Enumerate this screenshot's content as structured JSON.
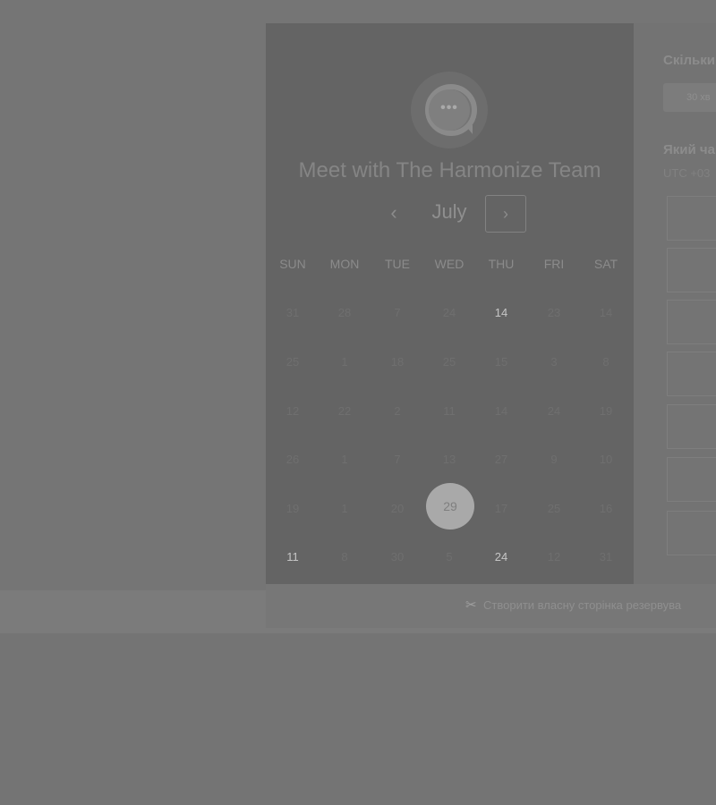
{
  "calendar": {
    "title": "Meet with The Harmonize Team",
    "logo_text": "•••",
    "month": "July",
    "prev_icon": "‹",
    "next_icon": "›",
    "weekdays": [
      "SUN",
      "MON",
      "TUE",
      "WED",
      "THU",
      "FRI",
      "SAT"
    ],
    "weeks": [
      [
        "31",
        "28",
        "7",
        "24",
        "14",
        "23",
        "14"
      ],
      [
        "25",
        "1",
        "18",
        "25",
        "15",
        "3",
        "8"
      ],
      [
        "12",
        "22",
        "2",
        "11",
        "14",
        "24",
        "19"
      ],
      [
        "26",
        "1",
        "7",
        "13",
        "27",
        "9",
        "10"
      ],
      [
        "19",
        "1",
        "20",
        "29",
        "17",
        "25",
        "16"
      ],
      [
        "11",
        "8",
        "30",
        "5",
        "24",
        "12",
        "31"
      ]
    ],
    "available_days": [
      "14",
      "11",
      "24"
    ],
    "selected_day": "29",
    "colors": {
      "selected_bg": "#a9a9a9",
      "available_text": "#c6c6c6"
    }
  },
  "right_panel": {
    "duration_label": "Скільки",
    "duration_value": "30 хв",
    "time_label": "Який ча",
    "timezone": "UTC +03"
  },
  "footer": {
    "icon": "scissors-icon",
    "text": "Створити власну сторінка резервува"
  }
}
